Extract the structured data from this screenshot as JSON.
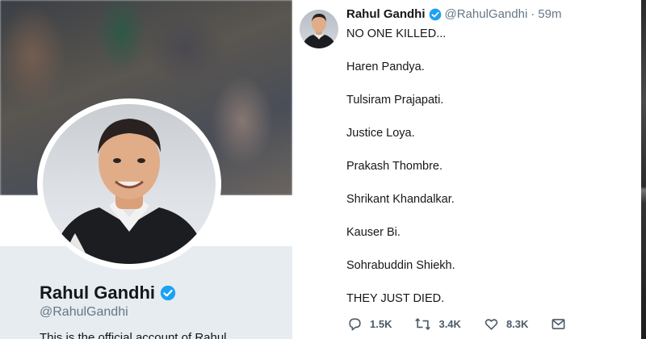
{
  "profile": {
    "display_name": "Rahul Gandhi",
    "handle": "@RahulGandhi",
    "bio_partial": "This is the official account of Rahul",
    "verified_icon": "verified-badge-icon",
    "colors": {
      "verified": "#1da1f2",
      "name": "#14171a",
      "muted": "#657786"
    }
  },
  "tweet": {
    "author_name": "Rahul Gandhi",
    "author_handle": "@RahulGandhi",
    "separator": "·",
    "time": "59m",
    "lines": [
      "NO ONE KILLED...",
      "Haren Pandya.",
      "Tulsiram Prajapati.",
      "Justice Loya.",
      "Prakash Thombre.",
      "Shrikant Khandalkar.",
      "Kauser Bi.",
      "Sohrabuddin Shiekh.",
      "THEY JUST DIED."
    ],
    "actions": {
      "reply": {
        "icon": "reply-icon",
        "count": "1.5K"
      },
      "retweet": {
        "icon": "retweet-icon",
        "count": "3.4K"
      },
      "like": {
        "icon": "heart-icon",
        "count": "8.3K"
      },
      "dm": {
        "icon": "envelope-icon"
      }
    }
  }
}
